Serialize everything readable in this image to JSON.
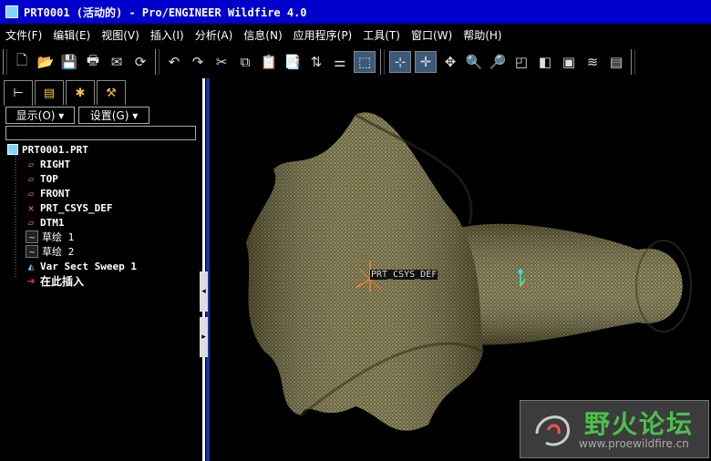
{
  "window": {
    "title": "PRT0001 (活动的) - Pro/ENGINEER Wildfire 4.0"
  },
  "menu": [
    "文件(F)",
    "编辑(E)",
    "视图(V)",
    "插入(I)",
    "分析(A)",
    "信息(N)",
    "应用程序(P)",
    "工具(T)",
    "窗口(W)",
    "帮助(H)"
  ],
  "panel": {
    "tabs": [
      "model-tree",
      "layers",
      "favorites",
      "tools"
    ],
    "show_label": "显示(O) ▾",
    "settings_label": "设置(G) ▾",
    "filter_value": ""
  },
  "tree": {
    "root": "PRT0001.PRT",
    "items": [
      {
        "label": "RIGHT",
        "icon": "datum-plane-icon"
      },
      {
        "label": "TOP",
        "icon": "datum-plane-icon"
      },
      {
        "label": "FRONT",
        "icon": "datum-plane-icon"
      },
      {
        "label": "PRT_CSYS_DEF",
        "icon": "csys-icon"
      },
      {
        "label": "DTM1",
        "icon": "datum-plane-icon"
      },
      {
        "label": "草绘 1",
        "icon": "sketch-icon"
      },
      {
        "label": "草绘 2",
        "icon": "sketch-icon"
      },
      {
        "label": "Var Sect Sweep 1",
        "icon": "sweep-icon"
      },
      {
        "label": "在此插入",
        "icon": "insert-here-arrow-icon"
      }
    ]
  },
  "viewport": {
    "csys_label": "PRT_CSYS_DEF"
  },
  "watermark": {
    "title": "野火论坛",
    "url": "www.proewildfire.cn"
  },
  "colors": {
    "titlebar": "#0000cc",
    "surface": "#6e6a40",
    "datum": "#ff7a3c"
  }
}
